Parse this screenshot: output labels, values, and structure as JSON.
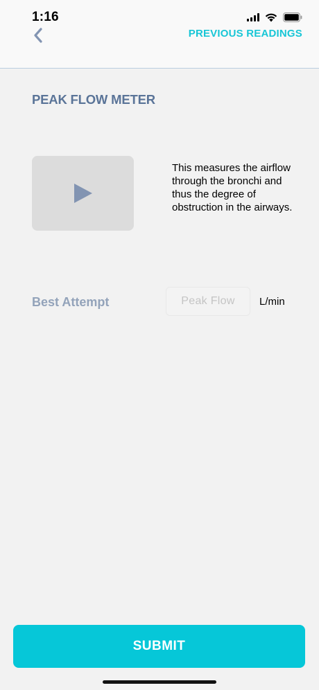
{
  "status_bar": {
    "time": "1:16",
    "icons": [
      "signal-icon",
      "wifi-icon",
      "battery-icon"
    ]
  },
  "header": {
    "back_icon": "chevron-left-icon",
    "previous_readings_label": "PREVIOUS READINGS"
  },
  "content": {
    "title": "PEAK FLOW METER",
    "video": {
      "icon": "play-icon"
    },
    "description": "This measures the airflow through the bronchi and thus the degree of obstruction in the airways.",
    "best_attempt_label": "Best Attempt",
    "peak_flow": {
      "placeholder": "Peak Flow",
      "value": ""
    },
    "unit": "L/min"
  },
  "footer": {
    "submit_label": "SUBMIT"
  },
  "colors": {
    "accent": "#06c7d8",
    "title": "#5a7498",
    "muted_label": "#93a3ba",
    "background": "#f2f2f2"
  }
}
